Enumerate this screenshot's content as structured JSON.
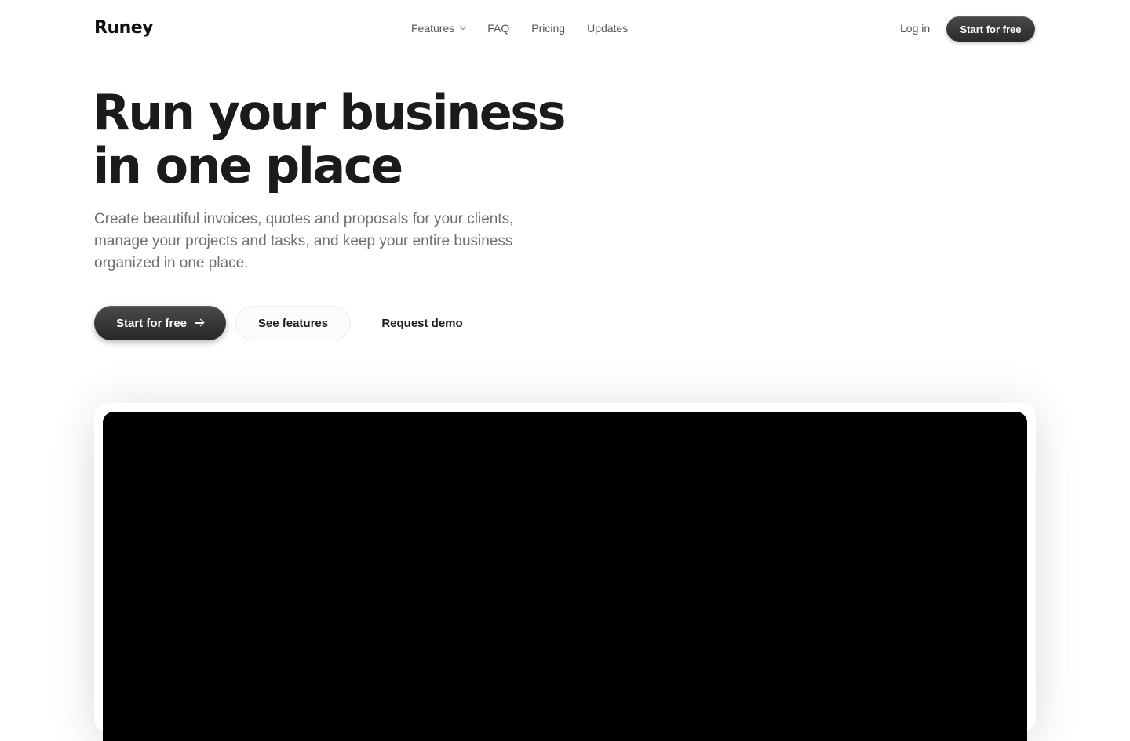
{
  "brand": {
    "name": "Runey"
  },
  "nav": {
    "links": [
      {
        "label": "Features",
        "has_dropdown": true,
        "icon": "chevron-down-icon"
      },
      {
        "label": "FAQ"
      },
      {
        "label": "Pricing"
      },
      {
        "label": "Updates"
      }
    ],
    "login_label": "Log in",
    "cta_label": "Start for free"
  },
  "hero": {
    "title_line1": "Run your business",
    "title_line2": "in one place",
    "subtitle": "Create beautiful invoices, quotes and proposals for your clients, manage your projects and tasks, and keep your entire business organized in one place.",
    "primary_cta": "Start for free",
    "primary_cta_icon": "arrow-right-icon",
    "secondary_cta": "See features",
    "tertiary_cta": "Request demo"
  },
  "colors": {
    "text": "#1b1b1b",
    "muted": "#6f6f6f",
    "button_dark": "#2a2a2a",
    "video_bg": "#000000"
  }
}
